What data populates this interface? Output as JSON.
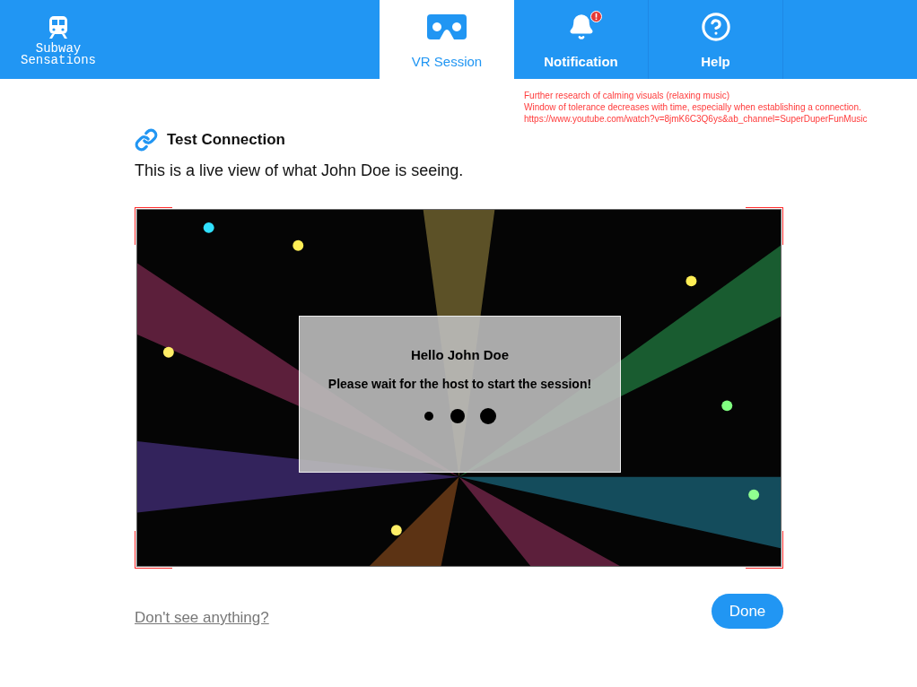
{
  "app": {
    "title": "Subway Sensations"
  },
  "tabs": [
    {
      "label": "VR Session",
      "kind": "vr",
      "selected": true,
      "alert": false
    },
    {
      "label": "Notification",
      "kind": "bell",
      "selected": false,
      "alert": true
    },
    {
      "label": "Help",
      "kind": "help",
      "selected": false,
      "alert": false
    }
  ],
  "notes": [
    "Further research of calming visuals (relaxing music)",
    "Window of tolerance decreases with time, especially when establishing a connection.",
    "https://www.youtube.com/watch?v=8jmK6C3Q6ys&ab_channel=SuperDuperFunMusic"
  ],
  "section": {
    "title": "Test Connection",
    "subtitle": "This is a live view of what John Doe is seeing."
  },
  "live_view": {
    "kind": "picture",
    "dialog": {
      "title": "Hello John Doe",
      "message": "Please wait for the host to start the session!"
    }
  },
  "help_link": "Don't see anything?",
  "done_button": "Done"
}
